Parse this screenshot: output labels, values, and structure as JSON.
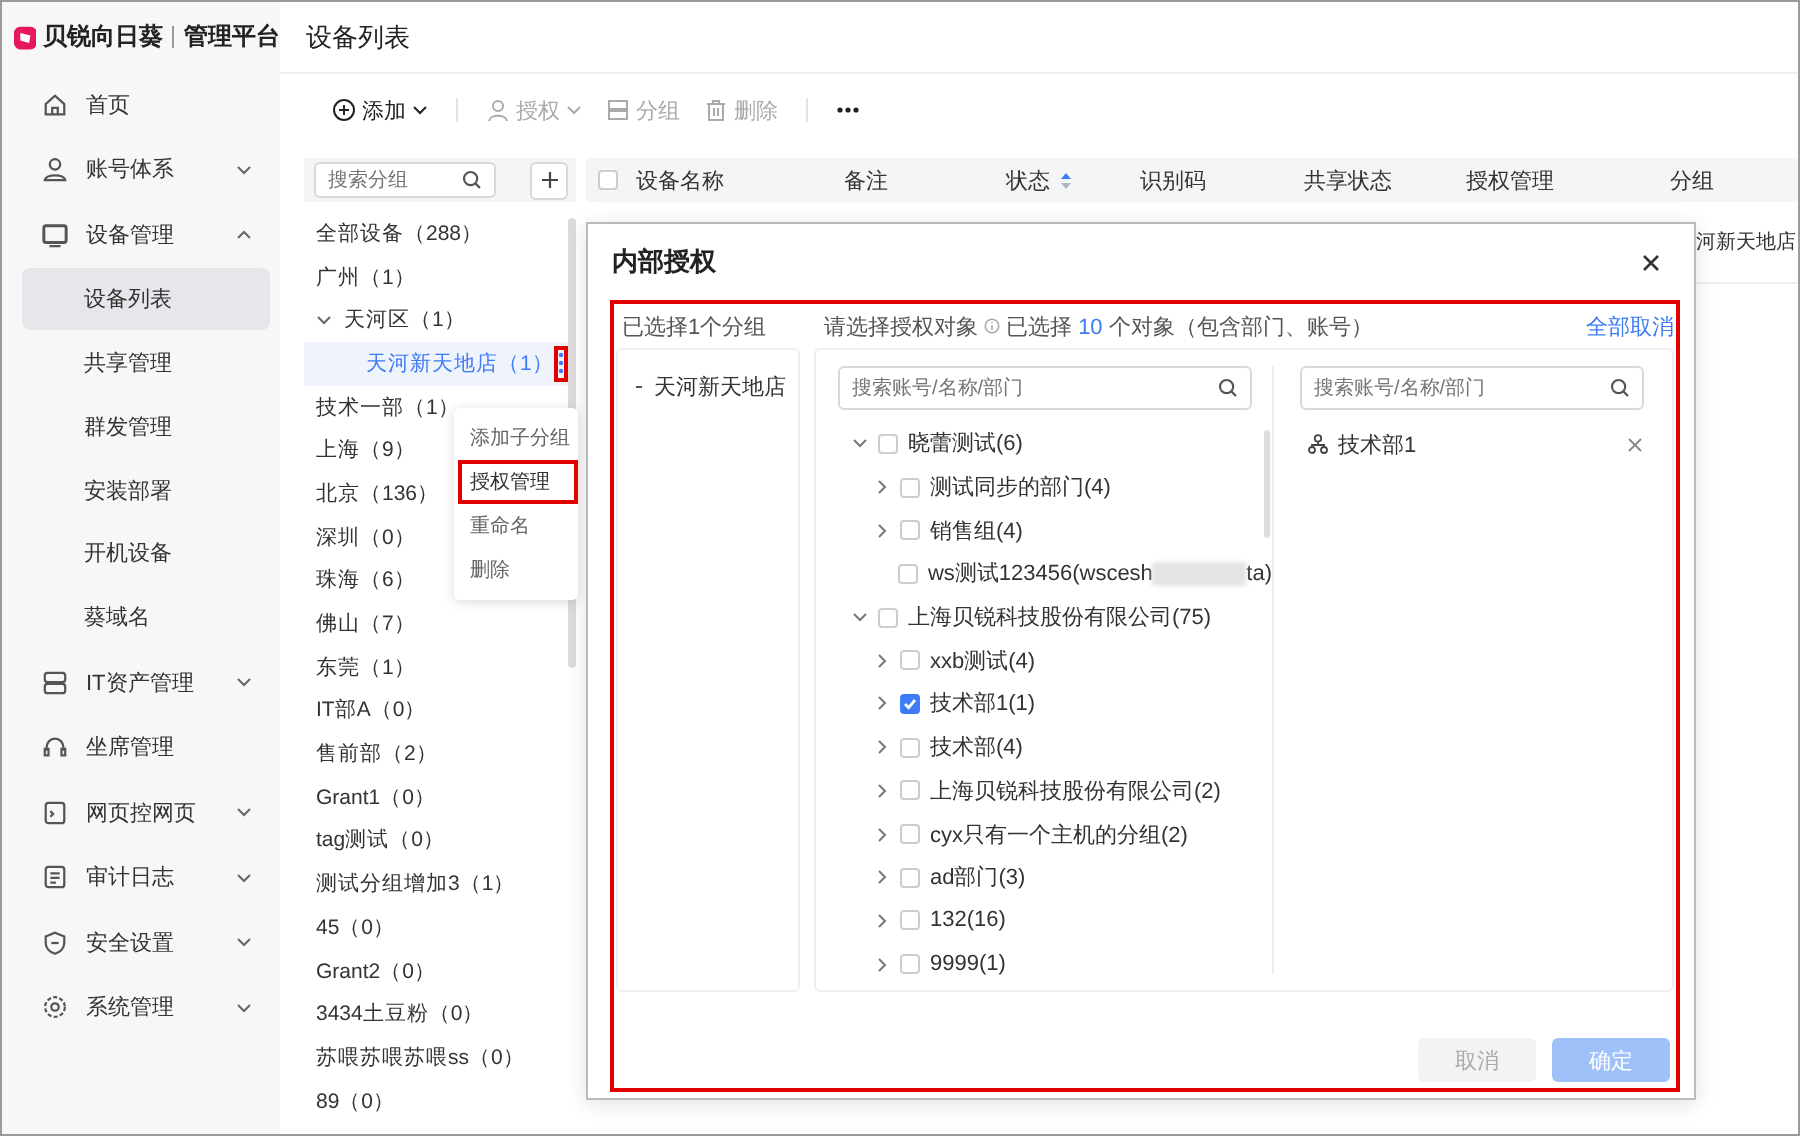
{
  "brand": {
    "name": "贝锐向日葵",
    "product": "管理平台"
  },
  "sidebar": {
    "items": [
      {
        "label": "首页",
        "selected": false
      },
      {
        "label": "账号体系",
        "selected": false,
        "expanded": false
      },
      {
        "label": "设备管理",
        "selected": false,
        "expanded": true,
        "children": [
          {
            "label": "设备列表",
            "selected": true
          },
          {
            "label": "共享管理",
            "selected": false
          },
          {
            "label": "群发管理",
            "selected": false
          },
          {
            "label": "安装部署",
            "selected": false
          },
          {
            "label": "开机设备",
            "selected": false
          },
          {
            "label": "葵域名",
            "selected": false
          }
        ]
      },
      {
        "label": "IT资产管理",
        "selected": false,
        "expanded": false
      },
      {
        "label": "坐席管理",
        "selected": false
      },
      {
        "label": "网页控网页",
        "selected": false,
        "expanded": false
      },
      {
        "label": "审计日志",
        "selected": false,
        "expanded": false
      },
      {
        "label": "安全设置",
        "selected": false,
        "expanded": false
      },
      {
        "label": "系统管理",
        "selected": false,
        "expanded": false
      }
    ]
  },
  "page_title": "设备列表",
  "toolbar": [
    {
      "label": "添加",
      "disabled": false
    },
    {
      "label": "授权",
      "disabled": true
    },
    {
      "label": "分组",
      "disabled": true
    },
    {
      "label": "删除",
      "disabled": true
    }
  ],
  "groups": {
    "search_placeholder": "搜索分组",
    "tree": [
      {
        "label": "全部设备（288）",
        "selected": false
      },
      {
        "label": "广州（1）",
        "selected": false
      },
      {
        "label": "天河区（1）",
        "selected": false,
        "expanded": true,
        "children": [
          {
            "label": "天河新天地店（1）",
            "selected": true,
            "marked": true
          }
        ]
      },
      {
        "label": "技术一部（1）",
        "selected": false
      },
      {
        "label": "上海（9）",
        "selected": false
      },
      {
        "label": "北京（136）",
        "selected": false
      },
      {
        "label": "深圳（0）",
        "selected": false
      },
      {
        "label": "珠海（6）",
        "selected": false
      },
      {
        "label": "佛山（7）",
        "selected": false
      },
      {
        "label": "东莞（1）",
        "selected": false
      },
      {
        "label": "IT部A（0）",
        "selected": false
      },
      {
        "label": "售前部（2）",
        "selected": false
      },
      {
        "label": "Grant1（0）",
        "selected": false
      },
      {
        "label": "tag测试（0）",
        "selected": false
      },
      {
        "label": "测试分组增加3（1）",
        "selected": false
      },
      {
        "label": "45（0）",
        "selected": false
      },
      {
        "label": "Grant2（0）",
        "selected": false
      },
      {
        "label": "3434土豆粉（0）",
        "selected": false
      },
      {
        "label": "苏喂苏喂苏喂ss（0）",
        "selected": false
      },
      {
        "label": "89（0）",
        "selected": false
      }
    ],
    "menu": [
      {
        "label": "添加子分组",
        "marked": false
      },
      {
        "label": "授权管理",
        "marked": true
      },
      {
        "label": "重命名",
        "marked": false
      },
      {
        "label": "删除",
        "marked": false
      }
    ]
  },
  "table": {
    "all_checked": false,
    "columns": [
      {
        "label": "设备名称",
        "sortable": false
      },
      {
        "label": "备注",
        "sortable": false
      },
      {
        "label": "状态",
        "sortable": true
      },
      {
        "label": "识别码",
        "sortable": false
      },
      {
        "label": "共享状态",
        "sortable": false
      },
      {
        "label": "授权管理",
        "sortable": false
      },
      {
        "label": "分组",
        "sortable": false
      }
    ],
    "rows": [
      {
        "group": "河新天地店"
      }
    ]
  },
  "dialog": {
    "title": "内部授权",
    "marked": true,
    "selected_groups_label": "已选择1个分组",
    "selected_groups": [
      "天河新天地店"
    ],
    "prompt": "请选择授权对象",
    "selection_prefix": "已选择",
    "selection_count": "10",
    "selection_suffix": "个对象（包含部门、账号）",
    "clear_all": "全部取消",
    "search_placeholder": "搜索账号/名称/部门",
    "tree": [
      {
        "label": "晓蕾测试(6)",
        "checked": false,
        "expanded": true,
        "children": [
          {
            "label": "测试同步的部门(4)",
            "checked": false,
            "expanded": false
          },
          {
            "label": "销售组(4)",
            "checked": false,
            "expanded": false
          },
          {
            "label": "ws测试123456(wscesh",
            "label_tail": "ta)",
            "redacted": true,
            "checked": false
          }
        ]
      },
      {
        "label": "上海贝锐科技股份有限公司(75)",
        "checked": false,
        "expanded": true,
        "children": [
          {
            "label": "xxb测试(4)",
            "checked": false,
            "expanded": false
          },
          {
            "label": "技术部1(1)",
            "checked": true,
            "expanded": false
          },
          {
            "label": "技术部(4)",
            "checked": false,
            "expanded": false
          },
          {
            "label": "上海贝锐科技股份有限公司(2)",
            "checked": false,
            "expanded": false
          },
          {
            "label": "cyx只有一个主机的分组(2)",
            "checked": false,
            "expanded": false
          },
          {
            "label": "ad部门(3)",
            "checked": false,
            "expanded": false
          },
          {
            "label": "132(16)",
            "checked": false,
            "expanded": false
          },
          {
            "label": "9999(1)",
            "checked": false,
            "expanded": false
          }
        ]
      }
    ],
    "selected_search_placeholder": "搜索账号/名称/部门",
    "selected_items": [
      {
        "label": "技术部1"
      }
    ],
    "buttons": [
      {
        "label": "取消",
        "kind": "cancel",
        "disabled": true
      },
      {
        "label": "确定",
        "kind": "confirm",
        "disabled": true
      }
    ]
  }
}
